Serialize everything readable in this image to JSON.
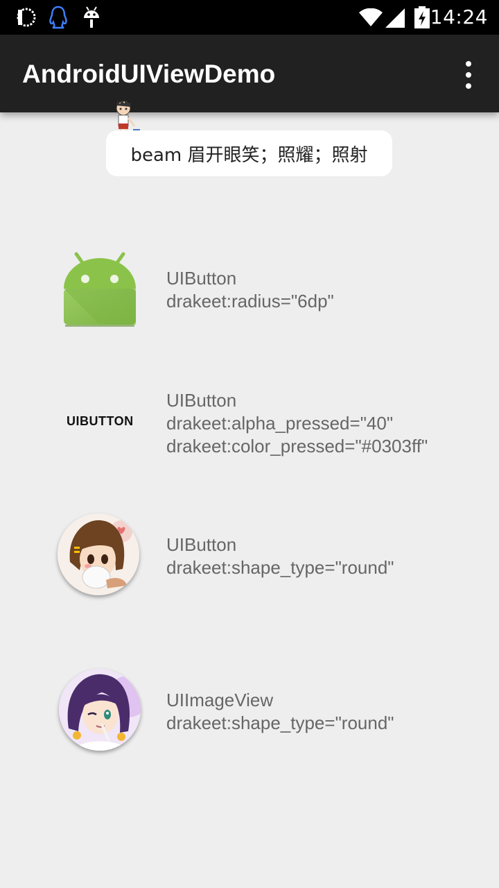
{
  "status_bar": {
    "time": "14:24",
    "left_icons": [
      "notification-app-icon",
      "qq-penguin-icon",
      "android-debug-icon"
    ],
    "right_icons": [
      "wifi-icon",
      "signal-icon",
      "battery-charging-icon"
    ]
  },
  "app_bar": {
    "title": "AndroidUIViewDemo",
    "menu_icon": "overflow-menu-icon"
  },
  "toast": {
    "text": "beam  眉开眼笑；照耀；照射"
  },
  "rows": [
    {
      "icon": "android-robot-icon",
      "lines": [
        "UIButton",
        "drakeet:radius=\"6dp\""
      ]
    },
    {
      "button_label": "UIBUTTON",
      "lines": [
        "UIButton",
        "drakeet:alpha_pressed=\"40\"",
        "drakeet:color_pressed=\"#0303ff\""
      ]
    },
    {
      "icon": "anime-avatar-round",
      "lines": [
        "UIButton",
        "drakeet:shape_type=\"round\""
      ]
    },
    {
      "icon": "anime-avatar-round",
      "lines": [
        "UIImageView",
        "drakeet:shape_type=\"round\""
      ]
    }
  ],
  "colors": {
    "status_bar": "#000000",
    "app_bar": "#212121",
    "background": "#eeeeee",
    "android_green": "#8bc34a",
    "row_text": "#666666"
  }
}
